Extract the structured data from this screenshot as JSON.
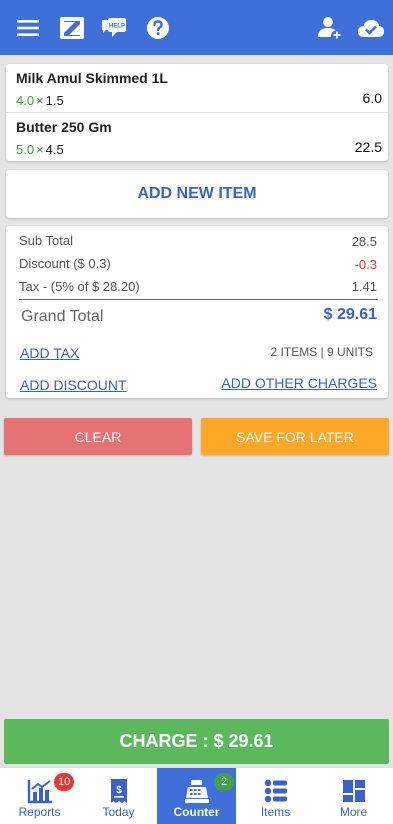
{
  "header": {
    "icons": [
      "menu-icon",
      "app-logo-icon",
      "help-chat-icon",
      "question-icon",
      "add-customer-icon",
      "cloud-sync-icon"
    ],
    "help_badge": "HELP",
    "logo_letter": "Z",
    "colors": {
      "bar": "#3f6fd8",
      "icon": "#ffffff"
    }
  },
  "items": [
    {
      "name": "Milk Amul Skimmed 1L",
      "qty": "4.0",
      "times": "×",
      "price": "1.5",
      "total": "6.0"
    },
    {
      "name": "Butter 250 Gm",
      "qty": "5.0",
      "times": "×",
      "price": "4.5",
      "total": "22.5"
    }
  ],
  "add_new_item_label": "ADD NEW ITEM",
  "summary": {
    "subtotal_label": "Sub Total",
    "subtotal_value": "28.5",
    "discount_label": "Discount ($ 0.3)",
    "discount_value": "-0.3",
    "tax_label": "Tax -  (5% of $ 28.20)",
    "tax_value": "1.41",
    "grand_total_label": "Grand Total",
    "grand_total_value": "$ 29.61",
    "add_tax_label": "ADD TAX",
    "counts_label": "2 ITEMS | 9 UNITS",
    "add_discount_label": "ADD DISCOUNT",
    "add_other_charges_label": "ADD OTHER CHARGES"
  },
  "actions": {
    "clear_label": "CLEAR",
    "save_label": "SAVE FOR LATER",
    "charge_label": "CHARGE : $ 29.61"
  },
  "bottom_nav": {
    "items": [
      {
        "label": "Reports",
        "icon": "reports-chart-icon",
        "badge": "10"
      },
      {
        "label": "Today",
        "icon": "receipt-dollar-icon",
        "badge": ""
      },
      {
        "label": "Counter",
        "icon": "cash-register-icon",
        "badge": "2",
        "active": true
      },
      {
        "label": "Items",
        "icon": "items-list-icon",
        "badge": ""
      },
      {
        "label": "More",
        "icon": "grid-more-icon",
        "badge": ""
      }
    ]
  },
  "colors": {
    "accent": "#3a62c8",
    "quantity_green": "#3aa23a",
    "negative_red": "#e53935",
    "clear_button": "#e57373",
    "save_button": "#ffa726",
    "charge_button": "#5cb85c"
  }
}
